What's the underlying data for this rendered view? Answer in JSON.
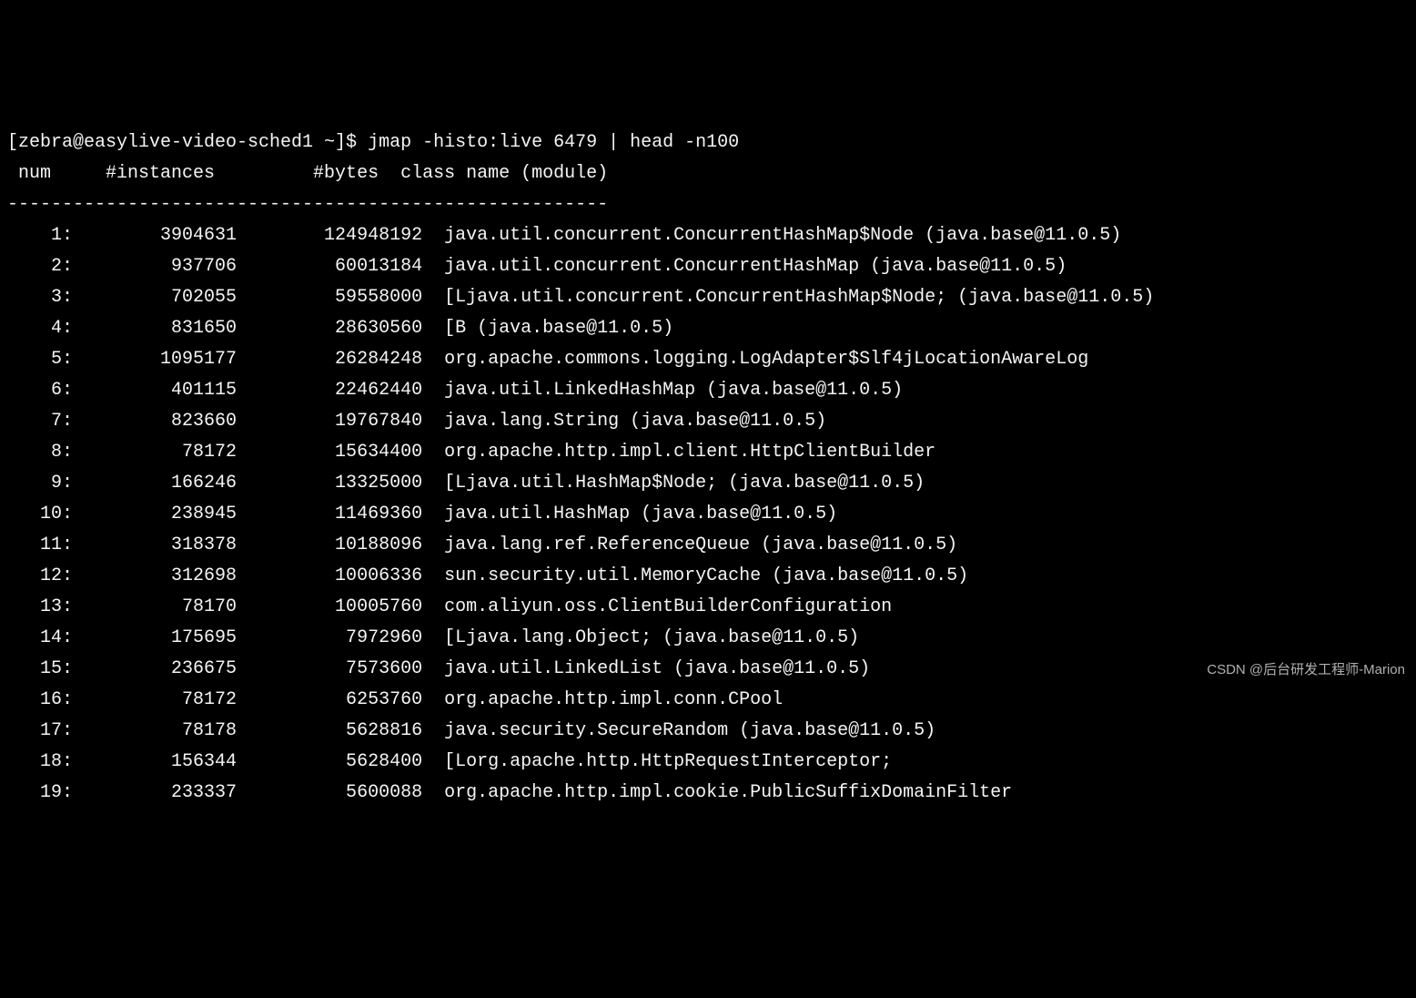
{
  "prompt": "[zebra@easylive-video-sched1 ~]$ ",
  "command": "jmap -histo:live 6479 | head -n100",
  "header": {
    "num": " num",
    "instances": "#instances",
    "bytes": "#bytes",
    "class_name": "class name (module)"
  },
  "separator": "-------------------------------------------------------",
  "rows": [
    {
      "num": "1:",
      "instances": "3904631",
      "bytes": "124948192",
      "class": "java.util.concurrent.ConcurrentHashMap$Node (java.base@11.0.5)"
    },
    {
      "num": "2:",
      "instances": "937706",
      "bytes": "60013184",
      "class": "java.util.concurrent.ConcurrentHashMap (java.base@11.0.5)"
    },
    {
      "num": "3:",
      "instances": "702055",
      "bytes": "59558000",
      "class": "[Ljava.util.concurrent.ConcurrentHashMap$Node; (java.base@11.0.5)"
    },
    {
      "num": "4:",
      "instances": "831650",
      "bytes": "28630560",
      "class": "[B (java.base@11.0.5)"
    },
    {
      "num": "5:",
      "instances": "1095177",
      "bytes": "26284248",
      "class": "org.apache.commons.logging.LogAdapter$Slf4jLocationAwareLog"
    },
    {
      "num": "6:",
      "instances": "401115",
      "bytes": "22462440",
      "class": "java.util.LinkedHashMap (java.base@11.0.5)"
    },
    {
      "num": "7:",
      "instances": "823660",
      "bytes": "19767840",
      "class": "java.lang.String (java.base@11.0.5)"
    },
    {
      "num": "8:",
      "instances": "78172",
      "bytes": "15634400",
      "class": "org.apache.http.impl.client.HttpClientBuilder"
    },
    {
      "num": "9:",
      "instances": "166246",
      "bytes": "13325000",
      "class": "[Ljava.util.HashMap$Node; (java.base@11.0.5)"
    },
    {
      "num": "10:",
      "instances": "238945",
      "bytes": "11469360",
      "class": "java.util.HashMap (java.base@11.0.5)"
    },
    {
      "num": "11:",
      "instances": "318378",
      "bytes": "10188096",
      "class": "java.lang.ref.ReferenceQueue (java.base@11.0.5)"
    },
    {
      "num": "12:",
      "instances": "312698",
      "bytes": "10006336",
      "class": "sun.security.util.MemoryCache (java.base@11.0.5)"
    },
    {
      "num": "13:",
      "instances": "78170",
      "bytes": "10005760",
      "class": "com.aliyun.oss.ClientBuilderConfiguration"
    },
    {
      "num": "14:",
      "instances": "175695",
      "bytes": "7972960",
      "class": "[Ljava.lang.Object; (java.base@11.0.5)"
    },
    {
      "num": "15:",
      "instances": "236675",
      "bytes": "7573600",
      "class": "java.util.LinkedList (java.base@11.0.5)"
    },
    {
      "num": "16:",
      "instances": "78172",
      "bytes": "6253760",
      "class": "org.apache.http.impl.conn.CPool"
    },
    {
      "num": "17:",
      "instances": "78178",
      "bytes": "5628816",
      "class": "java.security.SecureRandom (java.base@11.0.5)"
    },
    {
      "num": "18:",
      "instances": "156344",
      "bytes": "5628400",
      "class": "[Lorg.apache.http.HttpRequestInterceptor;"
    },
    {
      "num": "19:",
      "instances": "233337",
      "bytes": "5600088",
      "class": "org.apache.http.impl.cookie.PublicSuffixDomainFilter"
    }
  ],
  "watermark": "CSDN @后台研发工程师-Marion"
}
